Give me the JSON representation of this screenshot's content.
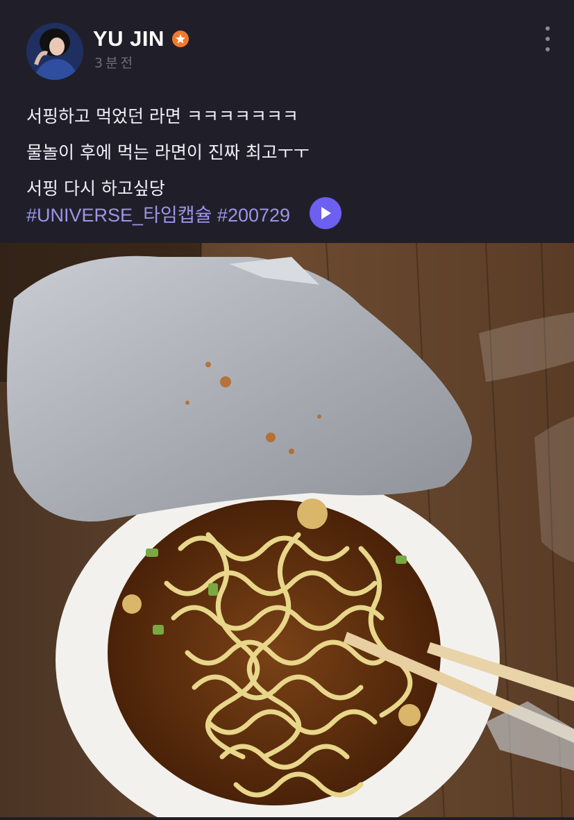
{
  "post": {
    "author_name": "YU JIN",
    "time_ago": "3분전",
    "text_lines": [
      "서핑하고 먹었던 라면 ㅋㅋㅋㅋㅋㅋㅋ",
      "물놀이 후에 먹는 라면이 진짜 최고ㅜㅜ",
      "서핑 다시 하고싶당"
    ],
    "hashtags": "#UNIVERSE_타임캡슐 #200729"
  },
  "icons": {
    "badge": "verified-star-icon",
    "more": "more-vertical-icon",
    "play": "play-icon"
  },
  "colors": {
    "background": "#201f29",
    "hashtag": "#9c95ea",
    "play_button": "#6d5ff0",
    "badge": "#f07a2c"
  }
}
